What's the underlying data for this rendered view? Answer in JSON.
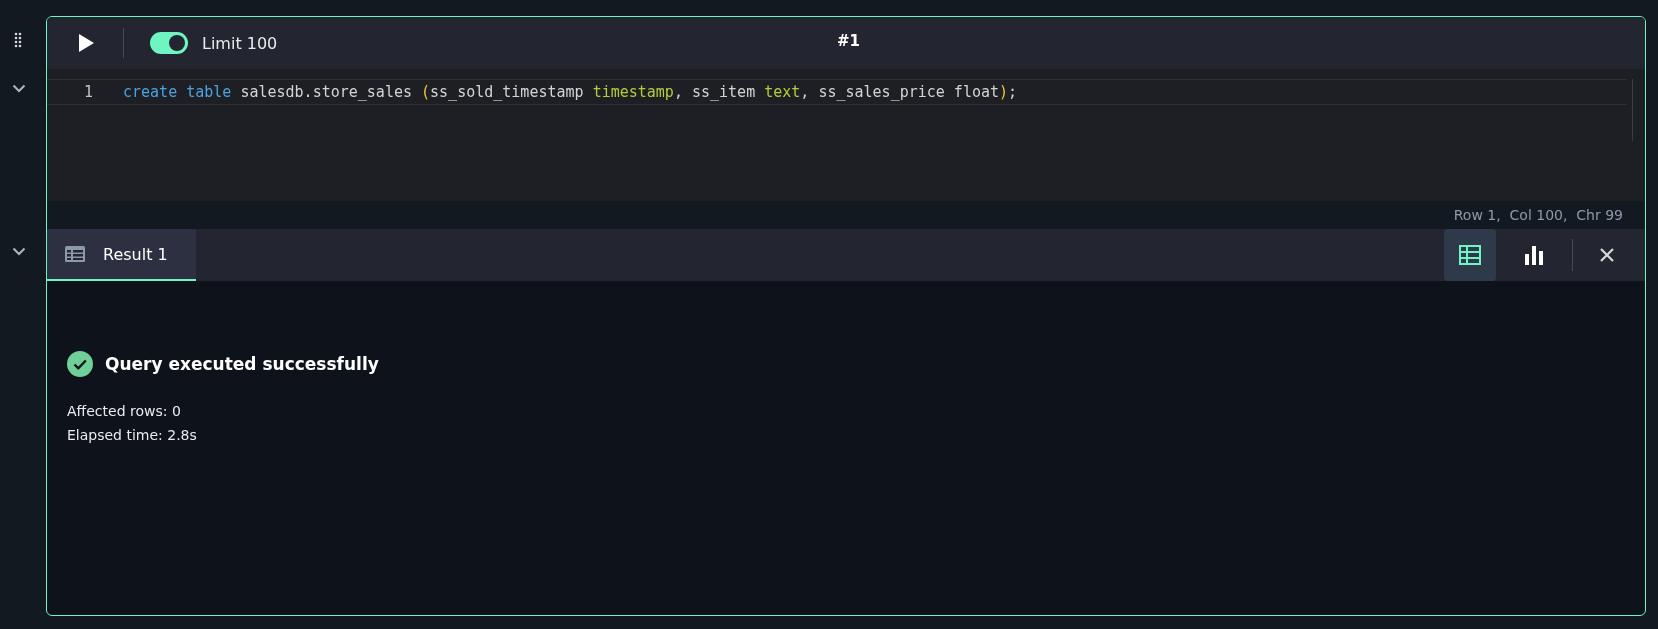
{
  "toolbar": {
    "limit": {
      "label": "Limit 100",
      "on": true
    },
    "cell_title": "#1"
  },
  "editor": {
    "lines": [
      {
        "number": "1",
        "tokens": [
          {
            "kind": "keyword",
            "text": "create"
          },
          {
            "kind": "keyword",
            "text": " table"
          },
          {
            "kind": "plain",
            "text": " salesdb.store_sales "
          },
          {
            "kind": "bracket",
            "text": "("
          },
          {
            "kind": "plain",
            "text": "ss_sold_timestamp "
          },
          {
            "kind": "type",
            "text": "timestamp"
          },
          {
            "kind": "plain",
            "text": ", ss_item "
          },
          {
            "kind": "type",
            "text": "text"
          },
          {
            "kind": "plain",
            "text": ", ss_sales_price float"
          },
          {
            "kind": "bracket",
            "text": ")"
          },
          {
            "kind": "plain",
            "text": ";"
          }
        ]
      }
    ]
  },
  "cursor_position": "Row 1,  Col 100,  Chr 99",
  "result_tabs": [
    {
      "label": "Result 1",
      "selected": true
    }
  ],
  "view_buttons": [
    {
      "kind": "table",
      "selected": true
    },
    {
      "kind": "chart",
      "selected": false
    }
  ],
  "result": {
    "status": "Query executed successfully",
    "details": [
      "Affected rows: 0",
      "Elapsed time: 2.8s"
    ]
  }
}
